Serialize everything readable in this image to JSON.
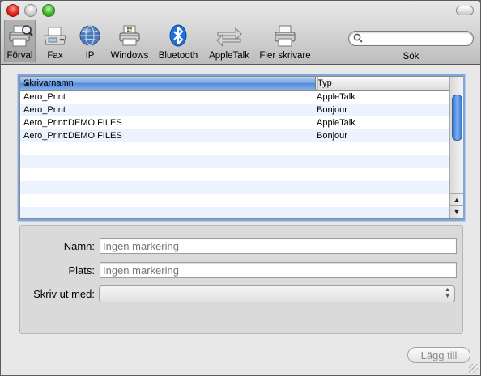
{
  "toolbar": {
    "items": [
      {
        "label": "Förval",
        "icon": "default-printer-icon",
        "selected": true
      },
      {
        "label": "Fax",
        "icon": "fax-icon"
      },
      {
        "label": "IP",
        "icon": "globe-icon"
      },
      {
        "label": "Windows",
        "icon": "windows-printer-icon"
      },
      {
        "label": "Bluetooth",
        "icon": "bluetooth-icon"
      },
      {
        "label": "AppleTalk",
        "icon": "appletalk-arrows-icon"
      },
      {
        "label": "Fler skrivare",
        "icon": "more-printers-icon"
      }
    ],
    "search": {
      "label": "Sök",
      "value": "",
      "placeholder": ""
    }
  },
  "printer_list": {
    "columns": [
      {
        "label": "Skrivarnamn",
        "sorted": "ascending"
      },
      {
        "label": "Typ"
      }
    ],
    "rows": [
      {
        "name": "Aero_Print",
        "type": "AppleTalk"
      },
      {
        "name": "Aero_Print",
        "type": "Bonjour"
      },
      {
        "name": "Aero_Print:DEMO FILES",
        "type": "AppleTalk"
      },
      {
        "name": "Aero_Print:DEMO FILES",
        "type": "Bonjour"
      }
    ]
  },
  "details": {
    "name_label": "Namn:",
    "name_placeholder": "Ingen markering",
    "location_label": "Plats:",
    "location_placeholder": "Ingen markering",
    "print_with_label": "Skriv ut med:",
    "print_with_value": ""
  },
  "actions": {
    "add_label": "Lägg till"
  },
  "colors": {
    "selection_header": "#6d9fdf",
    "focus_ring": "#7ea6dc",
    "alt_row": "#edf3fe"
  }
}
